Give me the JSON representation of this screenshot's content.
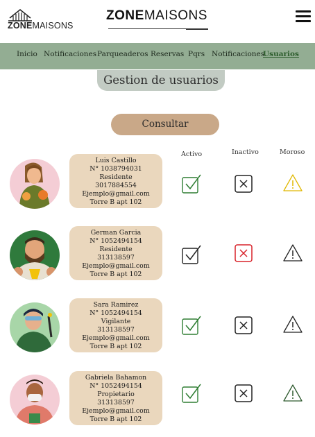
{
  "header": {
    "logo_text_bold": "ZONE",
    "logo_text_rest": "MAISONS",
    "title_bold": "ZONE",
    "title_rest": "MAISONS"
  },
  "nav": {
    "items": [
      {
        "label": "Inicio"
      },
      {
        "label": "Notificaciones"
      },
      {
        "label": "Parqueaderos"
      },
      {
        "label": "Reservas"
      },
      {
        "label": "Pqrs"
      },
      {
        "label": "Notificaciones"
      },
      {
        "label": "Usuarios",
        "active": true
      }
    ]
  },
  "page": {
    "heading": "Gestion de usuarios",
    "consult_label": "Consultar",
    "col_active": "Activo",
    "col_inactive": "Inactivo",
    "col_debtor": "Moroso"
  },
  "users": [
    {
      "name": "Luis  Castillo",
      "id": "N° 1038794031",
      "role": "Residente",
      "phone": "3017884554",
      "email": "Ejemplo@gmail.com",
      "unit": "Torre B apt 102",
      "inactive_color": "#222222",
      "debtor_color": "#e0b800"
    },
    {
      "name": "German Garcia",
      "id": "N° 1052494154",
      "role": "Residente",
      "phone": "313138597",
      "email": "Ejemplo@gmail.com",
      "unit": "Torre B apt 102",
      "inactive_color": "#d8222a",
      "debtor_color": "#222222"
    },
    {
      "name": "Sara Ramirez",
      "id": "N° 1052494154",
      "role": "Vigilante",
      "phone": "313138597",
      "email": "Ejemplo@gmail.com",
      "unit": "Torre B apt 102",
      "inactive_color": "#222222",
      "debtor_color": "#222222"
    },
    {
      "name": "Gabriela Bahamon",
      "id": "N° 1052494154",
      "role": "Propietario",
      "phone": "313138597",
      "email": "Ejemplo@gmail.com",
      "unit": "Torre B apt 102",
      "inactive_color": "#222222",
      "debtor_color": "#2e5a2e"
    }
  ],
  "colors": {
    "nav_bg": "#93ad93",
    "heading_bg": "#c2cbc3",
    "button_bg": "#c9a888",
    "card_bg": "#ead7bd",
    "check_green": "#2e7d32"
  }
}
